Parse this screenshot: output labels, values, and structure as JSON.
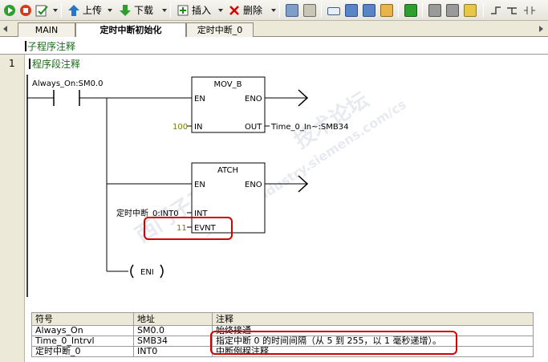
{
  "toolbar": {
    "upload_label": "上传",
    "download_label": "下载",
    "insert_label": "插入",
    "delete_label": "删除"
  },
  "tabs": [
    {
      "label": "MAIN"
    },
    {
      "label": "定时中断初始化"
    },
    {
      "label": "定时中断_0"
    }
  ],
  "editor": {
    "subroutine_comment": "子程序注释",
    "network_number": "1",
    "network_comment": "程序段注释"
  },
  "ladder": {
    "contact_label": "Always_On:SM0.0",
    "mov_b": {
      "title": "MOV_B",
      "en": "EN",
      "eno": "ENO",
      "in": "IN",
      "out": "OUT",
      "in_value": "100",
      "out_value": "Time_0_In~:SMB34"
    },
    "atch": {
      "title": "ATCH",
      "en": "EN",
      "eno": "ENO",
      "int": "INT",
      "evnt": "EVNT",
      "int_value": "定时中断_0:INT0",
      "evnt_value": "11"
    },
    "eni_label": "ENI"
  },
  "symbol_table": {
    "headers": [
      "符号",
      "地址",
      "注释"
    ],
    "rows": [
      [
        "Always_On",
        "SM0.0",
        "始终接通"
      ],
      [
        "Time_0_Intrvl",
        "SMB34",
        "指定中断 0 的时间间隔（从 5 到 255，以 1 毫秒递增）。"
      ],
      [
        "定时中断_0",
        "INT0",
        "中断例程注释"
      ]
    ]
  },
  "watermark": {
    "line1": "西门子工业",
    "line2": "support.industry.siemens.com/cs",
    "line3": "技术论坛"
  },
  "colors": {
    "comment_green": "#1a6b1a",
    "highlight_red": "#d40000",
    "constant_olive": "#7a7a00"
  }
}
